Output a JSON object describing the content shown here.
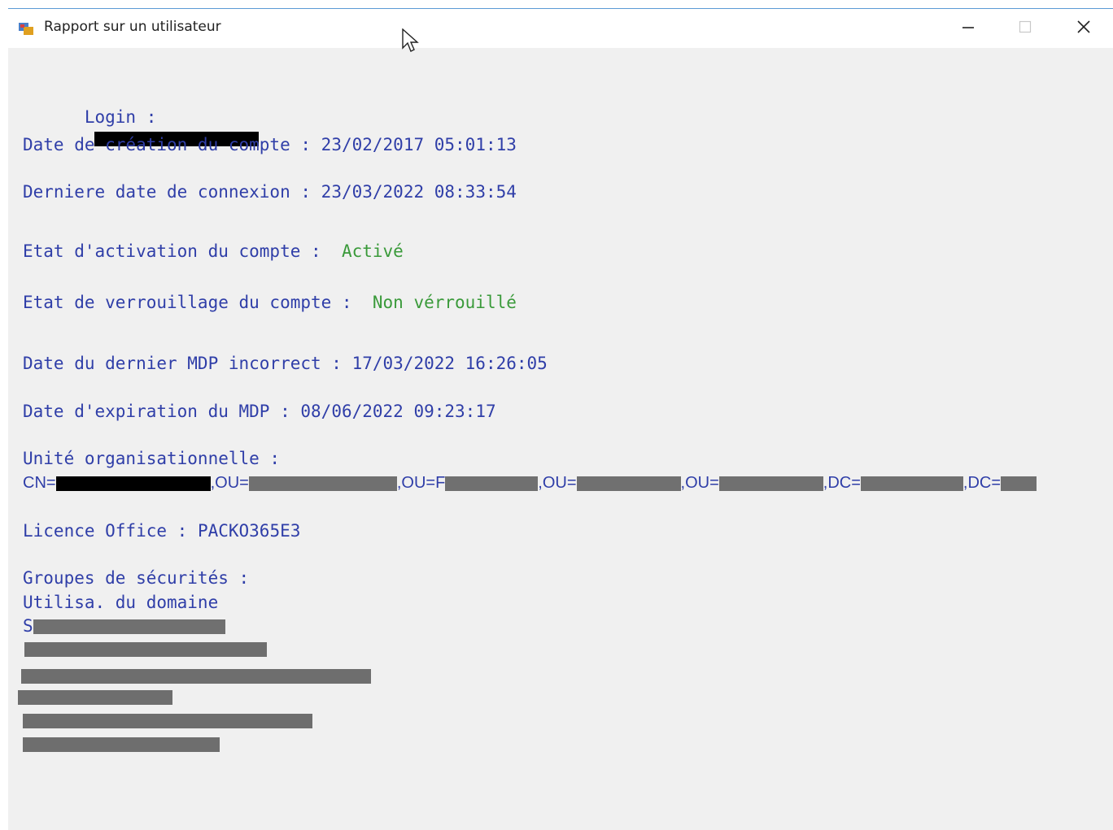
{
  "window": {
    "title": "Rapport sur un utilisateur"
  },
  "report": {
    "login_label": "Login :",
    "creation_date_label": "Date de création du compte :",
    "creation_date_value": "23/02/2017 05:01:13",
    "last_login_label": "Derniere date de connexion :",
    "last_login_value": "23/03/2022 08:33:54",
    "activation_label": "Etat d'activation du compte :",
    "activation_value": "Activé",
    "lock_label": "Etat de verrouillage du compte :",
    "lock_value": "Non vérrouillé",
    "bad_pwd_label": "Date du dernier MDP incorrect :",
    "bad_pwd_value": "17/03/2022 16:26:05",
    "pwd_expiry_label": "Date d'expiration du MDP :",
    "pwd_expiry_value": "08/06/2022 09:23:17",
    "ou_label": "Unité organisationnelle :",
    "ou_cn": "CN=",
    "ou_ou1": ",OU=",
    "ou_ou2": ",OU=F",
    "ou_ou3": ",OU=",
    "ou_ou4": ",OU=",
    "ou_dc1": ",DC=",
    "ou_dc2": ",DC=",
    "licence_label": "Licence Office :",
    "licence_value": "PACKO365E3",
    "groups_label": "Groupes de sécurités :",
    "group_1": "Utilisa. du domaine",
    "group_2_prefix": "S"
  },
  "colors": {
    "label": "#2f3ea8",
    "value_ok": "#3a9a3a",
    "window_bg": "#f0f0f0",
    "titlebar_bg": "#ffffff"
  },
  "icons": [
    "app-icon",
    "minimize-icon",
    "maximize-icon",
    "close-icon",
    "cursor-icon"
  ]
}
